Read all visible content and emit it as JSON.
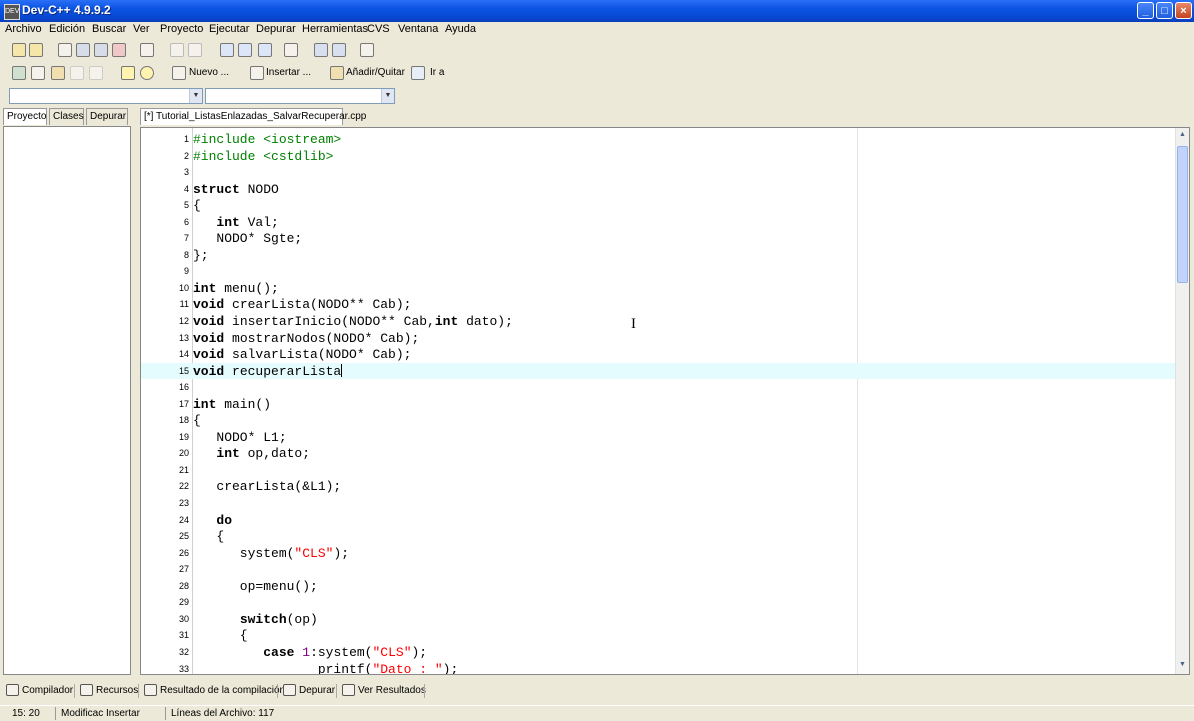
{
  "window": {
    "title": "Dev-C++ 4.9.9.2",
    "app_icon": "DEV"
  },
  "menu": [
    "Archivo",
    "Edición",
    "Buscar",
    "Ver",
    "Proyecto",
    "Ejecutar",
    "Depurar",
    "Herramientas",
    "CVS",
    "Ventana",
    "Ayuda"
  ],
  "toolbar2": {
    "new_label": "Nuevo ...",
    "insert_label": "Insertar ...",
    "add_remove_label": "Añadir/Quitar",
    "goto_label": "Ir a"
  },
  "side_tabs": [
    "Proyecto",
    "Clases",
    "Depurar"
  ],
  "editor": {
    "file_tab": "[*] Tutorial_ListasEnlazadas_SalvarRecuperar.cpp",
    "current_line": 15,
    "lines": [
      "#include <iostream>",
      "#include <cstdlib>",
      "",
      "struct NODO",
      "{",
      "   int Val;",
      "   NODO* Sgte;",
      "};",
      "",
      "int menu();",
      "void crearLista(NODO** Cab);",
      "void insertarInicio(NODO** Cab,int dato);",
      "void mostrarNodos(NODO* Cab);",
      "void salvarLista(NODO* Cab);",
      "void recuperarLista",
      "",
      "int main()",
      "{",
      "   NODO* L1;",
      "   int op,dato;",
      "",
      "   crearLista(&L1);",
      "",
      "   do",
      "   {",
      "      system(\"CLS\");",
      "",
      "      op=menu();",
      "",
      "      switch(op)",
      "      {",
      "         case 1:system(\"CLS\");",
      "                printf(\"Dato : \");"
    ]
  },
  "bottom_tabs": [
    "Compilador",
    "Recursos",
    "Resultado de la compilación",
    "Depurar",
    "Ver Resultados"
  ],
  "status": {
    "position": "15: 20",
    "mode": "Modificac Insertar",
    "lines": "Líneas del Archivo: 117"
  }
}
